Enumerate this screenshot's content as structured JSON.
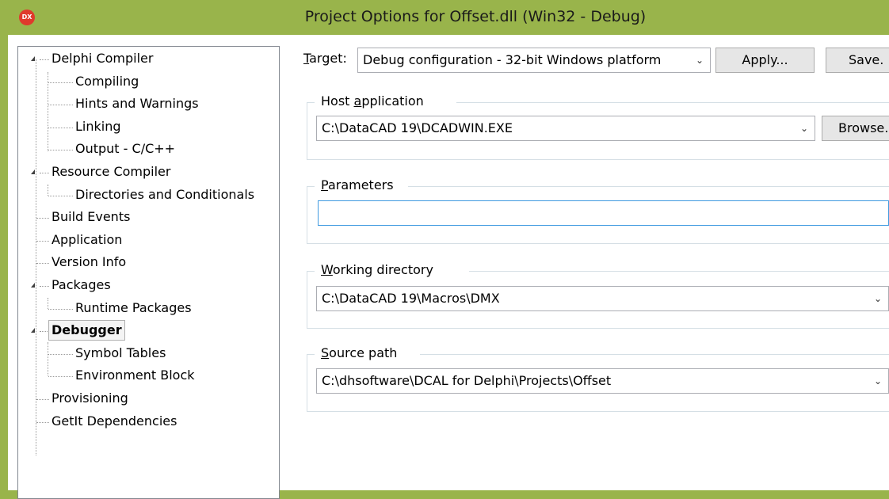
{
  "window": {
    "title": "Project Options for Offset.dll  (Win32 - Debug)",
    "app_icon_text": "DX",
    "accent_color": "#99b44b"
  },
  "tree": {
    "items": [
      {
        "label": "Delphi Compiler",
        "level": 0,
        "expanded": true
      },
      {
        "label": "Compiling",
        "level": 1
      },
      {
        "label": "Hints and Warnings",
        "level": 1
      },
      {
        "label": "Linking",
        "level": 1
      },
      {
        "label": "Output - C/C++",
        "level": 1
      },
      {
        "label": "Resource Compiler",
        "level": 0,
        "expanded": true
      },
      {
        "label": "Directories and Conditionals",
        "level": 1
      },
      {
        "label": "Build Events",
        "level": 0
      },
      {
        "label": "Application",
        "level": 0
      },
      {
        "label": "Version Info",
        "level": 0
      },
      {
        "label": "Packages",
        "level": 0,
        "expanded": true
      },
      {
        "label": "Runtime Packages",
        "level": 1
      },
      {
        "label": "Debugger",
        "level": 0,
        "expanded": true,
        "selected": true
      },
      {
        "label": "Symbol Tables",
        "level": 1
      },
      {
        "label": "Environment Block",
        "level": 1
      },
      {
        "label": "Provisioning",
        "level": 0
      },
      {
        "label": "GetIt Dependencies",
        "level": 0
      }
    ]
  },
  "target": {
    "label_prefix": "",
    "label_mnemonic": "T",
    "label_rest": "arget:",
    "value": "Debug configuration - 32-bit Windows platform",
    "apply_label": "Apply...",
    "save_label": "Save."
  },
  "host_application": {
    "label_pre": "Host ",
    "label_mnemonic": "a",
    "label_post": "pplication",
    "value": "C:\\DataCAD 19\\DCADWIN.EXE",
    "browse_label": "Browse."
  },
  "parameters": {
    "label_pre": "",
    "label_mnemonic": "P",
    "label_post": "arameters",
    "value": ""
  },
  "working_directory": {
    "label_pre": "",
    "label_mnemonic": "W",
    "label_post": "orking directory",
    "value": "C:\\DataCAD 19\\Macros\\DMX"
  },
  "source_path": {
    "label_pre": "",
    "label_mnemonic": "S",
    "label_post": "ource path",
    "value": "C:\\dhsoftware\\DCAL for Delphi\\Projects\\Offset"
  }
}
